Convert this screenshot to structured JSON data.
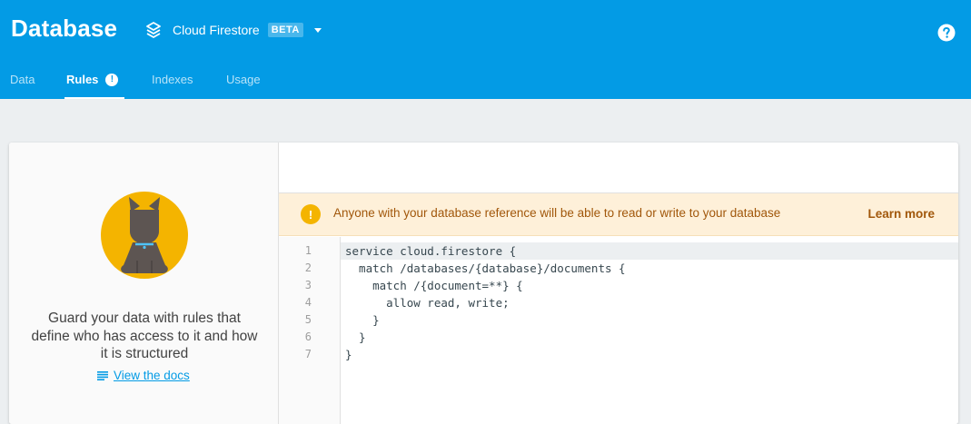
{
  "header": {
    "title": "Database",
    "database_name": "Cloud Firestore",
    "beta_badge": "BETA"
  },
  "tabs": [
    {
      "label": "Data",
      "active": false
    },
    {
      "label": "Rules",
      "active": true,
      "alert_badge": "!"
    },
    {
      "label": "Indexes",
      "active": false
    },
    {
      "label": "Usage",
      "active": false
    }
  ],
  "left_panel": {
    "description": "Guard your data with rules that define who has access to it and how it is structured",
    "docs_link_label": "View the docs"
  },
  "warning": {
    "icon_glyph": "!",
    "message": "Anyone with your database reference will be able to read or write to your database",
    "learn_more_label": "Learn more"
  },
  "editor": {
    "current_line": 1,
    "line_numbers": [
      "1",
      "2",
      "3",
      "4",
      "5",
      "6",
      "7"
    ],
    "lines": [
      "service cloud.firestore {",
      "  match /databases/{database}/documents {",
      "    match /{document=**} {",
      "      allow read, write;",
      "    }",
      "  }",
      "}"
    ]
  },
  "icons": {
    "firestore": "firestore-icon",
    "help": "help-icon",
    "docs": "doc-lines-icon",
    "warning": "warning-icon",
    "dropdown": "caret-down-icon"
  },
  "colors": {
    "header_bg": "#039be5",
    "page_bg": "#eceff1",
    "warning_bg": "#fef0d9",
    "warning_text": "#a1570b",
    "warning_icon": "#f4b400",
    "link": "#039be5",
    "illustration_circle": "#f4b400",
    "illustration_dog": "#5d5552"
  }
}
